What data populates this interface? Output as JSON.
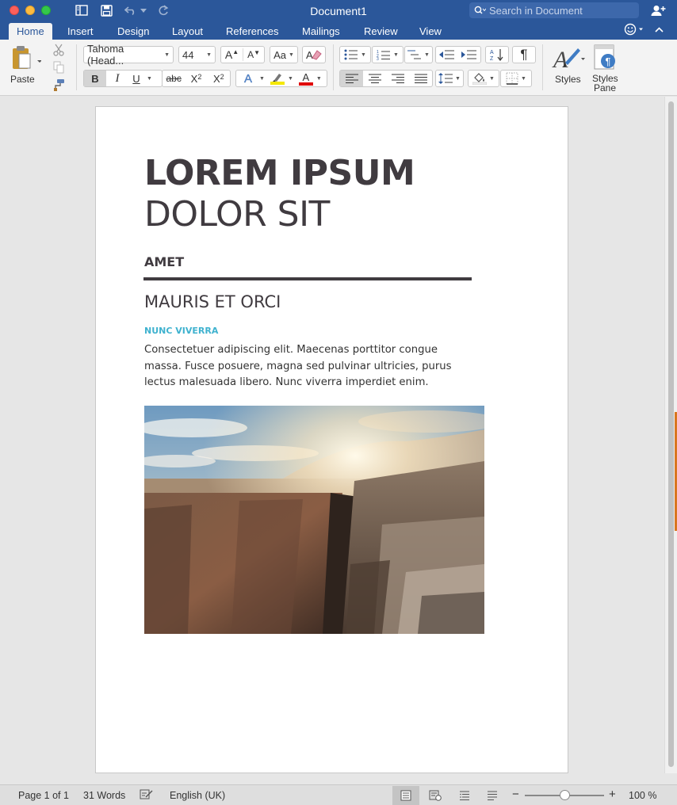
{
  "window": {
    "title": "Document1",
    "search_placeholder": "Search in Document"
  },
  "tabs": [
    {
      "label": "Home",
      "active": true
    },
    {
      "label": "Insert"
    },
    {
      "label": "Design"
    },
    {
      "label": "Layout"
    },
    {
      "label": "References"
    },
    {
      "label": "Mailings"
    },
    {
      "label": "Review"
    },
    {
      "label": "View"
    }
  ],
  "ribbon": {
    "paste_label": "Paste",
    "font_name": "Tahoma (Head...",
    "font_size": "44",
    "bold_label": "B",
    "italic_label": "I",
    "underline_label": "U",
    "strike_label": "abc",
    "subscript_label": "X",
    "subscript_sub": "2",
    "superscript_label": "X",
    "superscript_sup": "2",
    "font_color_label": "A",
    "highlight_color": "#f5e800",
    "font_color": "#e00000",
    "styles_label": "Styles",
    "styles_pane_label_1": "Styles",
    "styles_pane_label_2": "Pane",
    "accent_color": "#2b579a"
  },
  "document": {
    "title_line1": "LOREM IPSUM",
    "title_line2": "DOLOR SIT",
    "subtitle": "AMET",
    "heading1": "MAURIS ET ORCI",
    "heading2": "NUNC VIVERRA",
    "body": "Consectetuer adipiscing elit. Maecenas porttitor congue massa. Fusce posuere, magna sed pulvinar ultricies, purus lectus malesuada libero. Nunc viverra imperdiet enim.",
    "heading2_color": "#3fb2cf",
    "text_color": "#403b40"
  },
  "status": {
    "page": "Page 1 of 1",
    "words": "31 Words",
    "language": "English (UK)",
    "zoom": "100 %",
    "zoom_minus": "−",
    "zoom_plus": "+"
  }
}
